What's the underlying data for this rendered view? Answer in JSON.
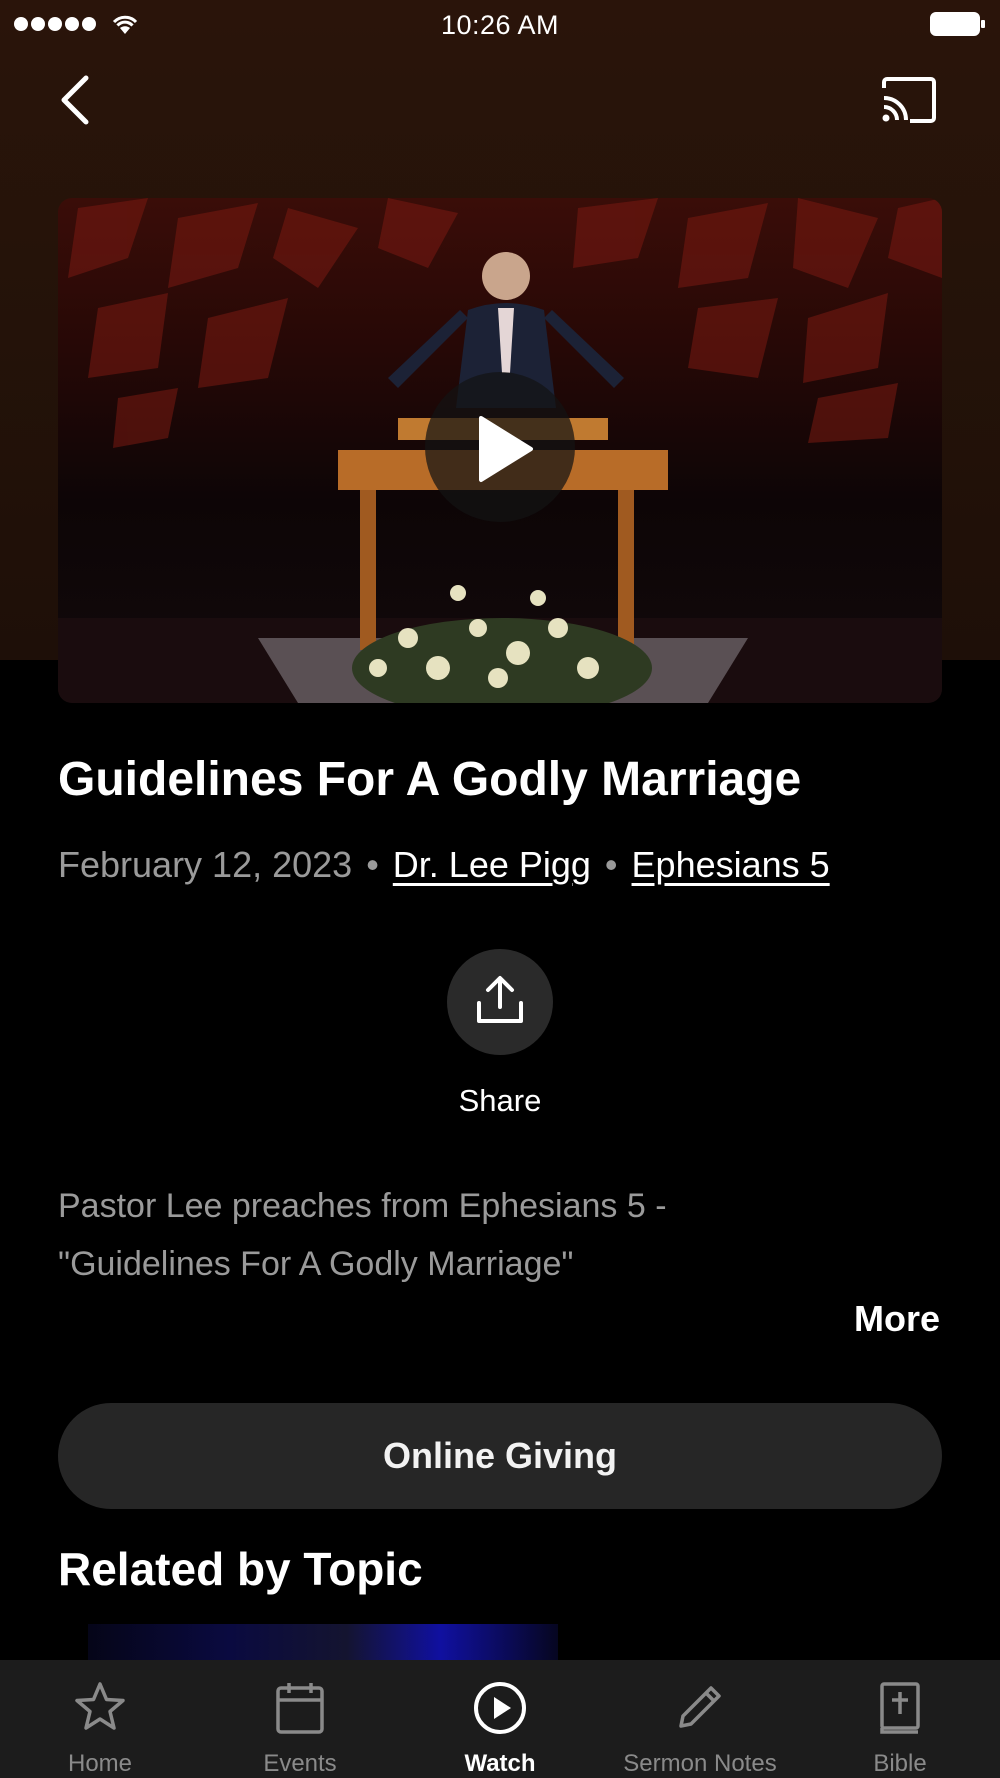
{
  "status_bar": {
    "time": "10:26 AM"
  },
  "video": {
    "title": "Guidelines For A Godly Marriage"
  },
  "meta": {
    "date": "February 12, 2023",
    "separator": "•",
    "speaker": "Dr. Lee Pigg",
    "scripture": "Ephesians 5"
  },
  "share": {
    "label": "Share"
  },
  "description": {
    "line1": "Pastor Lee preaches from Ephesians 5 -",
    "line2": "\"Guidelines For A Godly Marriage\"",
    "more_label": "More"
  },
  "giving": {
    "label": "Online Giving"
  },
  "related": {
    "title": "Related by Topic"
  },
  "tabs": [
    {
      "label": "Home",
      "icon": "star-icon",
      "active": false
    },
    {
      "label": "Events",
      "icon": "calendar-icon",
      "active": false
    },
    {
      "label": "Watch",
      "icon": "play-circle-icon",
      "active": true
    },
    {
      "label": "Sermon Notes",
      "icon": "pencil-icon",
      "active": false
    },
    {
      "label": "Bible",
      "icon": "bible-icon",
      "active": false
    }
  ],
  "colors": {
    "background": "#000000",
    "header_gradient": "#2a140a",
    "secondary_text": "#9a9a9a",
    "button_bg": "#262626",
    "tab_bar_bg": "#1c1c1c"
  }
}
